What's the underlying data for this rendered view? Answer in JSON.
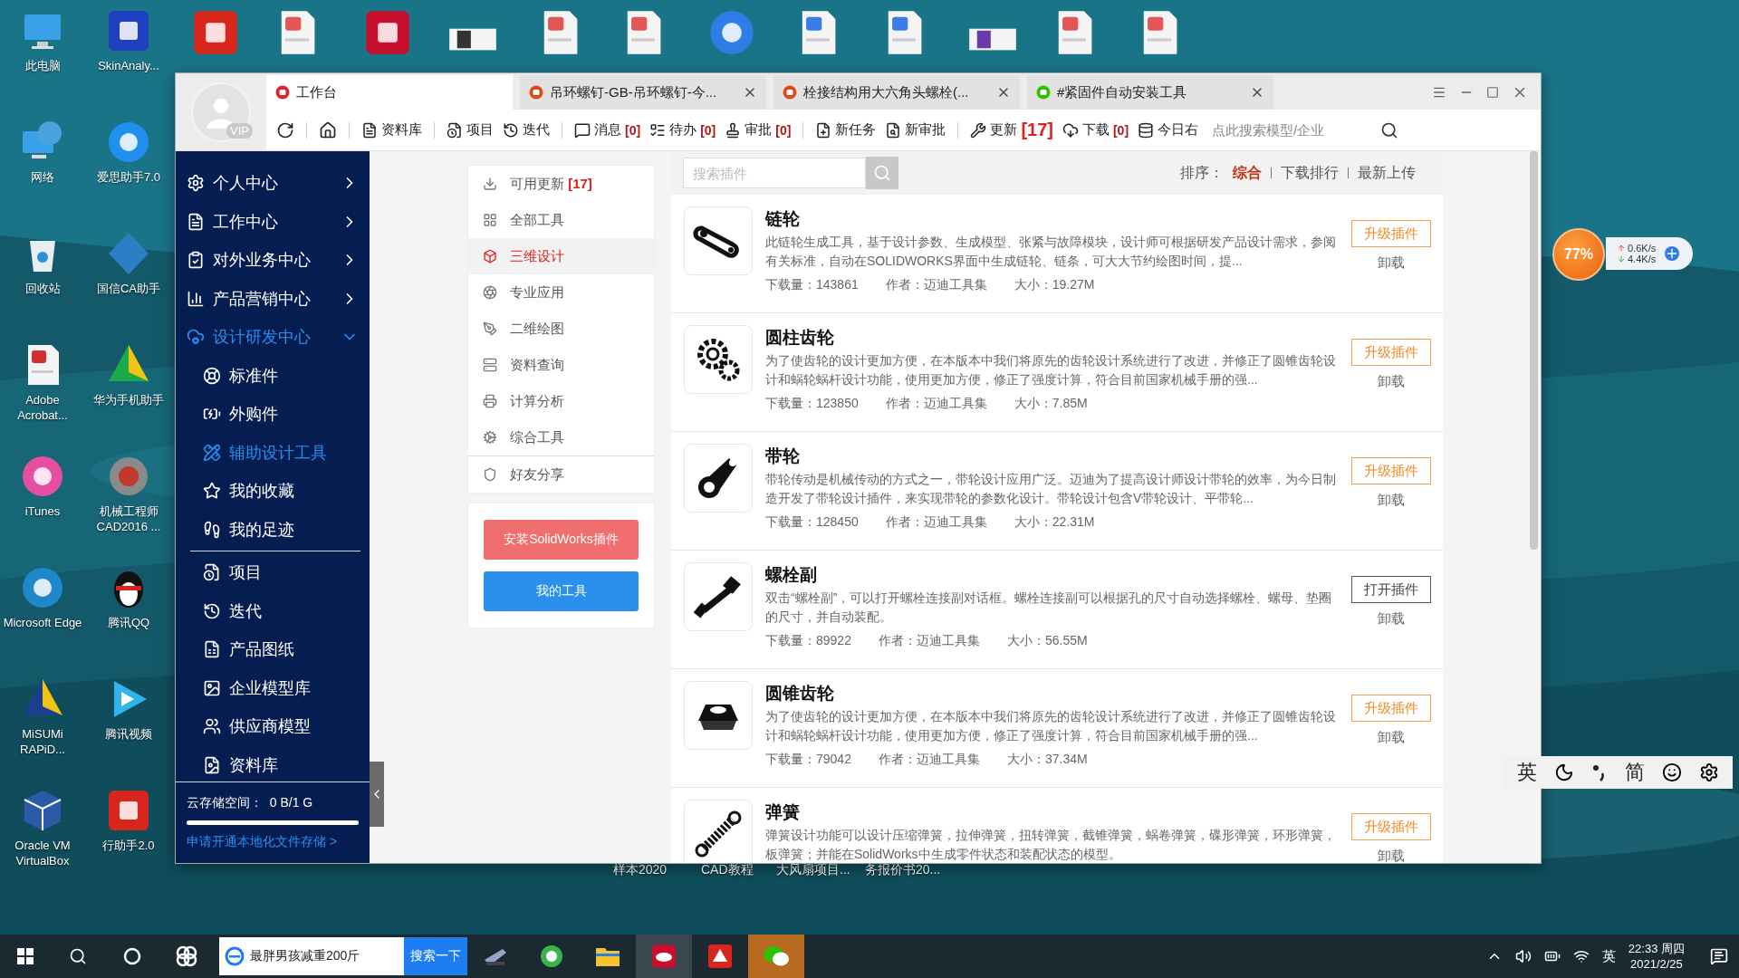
{
  "desktop": {
    "icons": [
      {
        "label": "此电脑"
      },
      {
        "label": "SkinAnaly..."
      },
      {
        "label": "网络"
      },
      {
        "label": "爱思助手7.0"
      },
      {
        "label": "回收站"
      },
      {
        "label": "国信CA助手"
      },
      {
        "label": "Adobe Acrobat..."
      },
      {
        "label": "华为手机助手"
      },
      {
        "label": "iTunes"
      },
      {
        "label": "机械工程师 CAD2016 ..."
      },
      {
        "label": "Microsoft Edge"
      },
      {
        "label": "腾讯QQ"
      },
      {
        "label": "MiSUMi RAPiD..."
      },
      {
        "label": "腾讯视频"
      },
      {
        "label": "Oracle VM VirtualBox"
      },
      {
        "label": "行助手2.0"
      }
    ],
    "bottom_labels": [
      "样本2020",
      "CAD教程",
      "大风扇项目...",
      "务报价书20..."
    ]
  },
  "window": {
    "avatar_badge": "VIP",
    "tabs": [
      {
        "label": "工作台",
        "selected": true
      },
      {
        "label": "吊环螺钉-GB-吊环螺钉-今...",
        "selected": false
      },
      {
        "label": "栓接结构用大六角头螺栓(...",
        "selected": false
      },
      {
        "label": "#紧固件自动安装工具",
        "selected": false
      }
    ],
    "toolbar": {
      "groups": [
        [
          {
            "label": "资料库"
          }
        ],
        [
          {
            "label": "项目"
          },
          {
            "label": "迭代"
          }
        ],
        [
          {
            "label": "消息",
            "count": "[0]"
          },
          {
            "label": "待办",
            "count": "[0]"
          },
          {
            "label": "审批",
            "count": "[0]"
          }
        ],
        [
          {
            "label": "新任务"
          },
          {
            "label": "新审批"
          }
        ],
        [
          {
            "label": "更新",
            "count": "[17]"
          },
          {
            "label": "下载",
            "count": "[0]"
          },
          {
            "label": "今日右"
          }
        ]
      ],
      "search_placeholder": "点此搜索模型/企业"
    },
    "sidebar": {
      "groups": [
        {
          "label": "个人中心",
          "expanded": false
        },
        {
          "label": "工作中心",
          "expanded": false
        },
        {
          "label": "对外业务中心",
          "expanded": false
        },
        {
          "label": "产品营销中心",
          "expanded": false
        },
        {
          "label": "设计研发中心",
          "expanded": true,
          "children": [
            {
              "label": "标准件",
              "selected": false
            },
            {
              "label": "外购件",
              "selected": false
            },
            {
              "label": "辅助设计工具",
              "selected": true
            },
            {
              "label": "我的收藏",
              "selected": false
            },
            {
              "label": "我的足迹",
              "selected": false
            }
          ]
        }
      ],
      "items": [
        "项目",
        "迭代",
        "产品图纸",
        "企业模型库",
        "供应商模型",
        "资料库"
      ],
      "storage": {
        "label": "云存储空间：",
        "value": "0 B/1 G",
        "level": 0,
        "link": "申请开通本地化文件存储 >"
      }
    },
    "categories": [
      {
        "label": "可用更新",
        "count": "[17]",
        "selected": false
      },
      {
        "label": "全部工具",
        "selected": false
      },
      {
        "label": "三维设计",
        "selected": true
      },
      {
        "label": "专业应用",
        "selected": false
      },
      {
        "label": "二维绘图",
        "selected": false
      },
      {
        "label": "资料查询",
        "selected": false
      },
      {
        "label": "计算分析",
        "selected": false
      },
      {
        "label": "综合工具",
        "selected": false
      },
      {
        "label": "好友分享",
        "selected": false
      }
    ],
    "buttons": [
      {
        "label": "安装SolidWorks插件",
        "kind": "install"
      },
      {
        "label": "我的工具",
        "kind": "tools"
      }
    ],
    "plugin_search": {
      "placeholder": "搜索插件"
    },
    "sort": {
      "label": "排序：",
      "options": [
        {
          "label": "综合",
          "selected": true
        },
        {
          "label": "下载排行",
          "selected": false
        },
        {
          "label": "最新上传",
          "selected": false
        }
      ]
    },
    "plugins": [
      {
        "name": "链轮",
        "description": "此链轮生成工具，基于设计参数、生成模型、张紧与故障模块，设计师可根据研发产品设计需求，参阅有关标准，自动在SOLIDWORKS界面中生成链轮、链条，可大大节约绘图时间，提...",
        "downloads": "下载量：143861",
        "author": "作者：迈迪工具集",
        "size": "大小：19.27M",
        "action": {
          "label": "升级插件",
          "kind": "upgrade"
        },
        "uninstall": "卸载"
      },
      {
        "name": "圆柱齿轮",
        "description": "为了使齿轮的设计更加方便，在本版本中我们将原先的齿轮设计系统进行了改进，并修正了圆锥齿轮设计和蜗轮蜗杆设计功能，使用更加方便，修正了强度计算，符合目前国家机械手册的强...",
        "downloads": "下载量：123850",
        "author": "作者：迈迪工具集",
        "size": "大小：7.85M",
        "action": {
          "label": "升级插件",
          "kind": "upgrade"
        },
        "uninstall": "卸载"
      },
      {
        "name": "带轮",
        "description": "带轮传动是机械传动的方式之一，带轮设计应用广泛。迈迪为了提高设计师设计带轮的效率，为今日制造开发了带轮设计插件，来实现带轮的参数化设计。带轮设计包含V带轮设计、平带轮...",
        "downloads": "下载量：128450",
        "author": "作者：迈迪工具集",
        "size": "大小：22.31M",
        "action": {
          "label": "升级插件",
          "kind": "upgrade"
        },
        "uninstall": "卸载"
      },
      {
        "name": "螺栓副",
        "description": "双击“螺栓副”，可以打开螺栓连接副对话框。螺栓连接副可以根据孔的尺寸自动选择螺栓、螺母、垫圈的尺寸，并自动装配。",
        "downloads": "下载量：89922",
        "author": "作者：迈迪工具集",
        "size": "大小：56.55M",
        "action": {
          "label": "打开插件",
          "kind": "open"
        },
        "uninstall": "卸载"
      },
      {
        "name": "圆锥齿轮",
        "description": "为了使齿轮的设计更加方便，在本版本中我们将原先的齿轮设计系统进行了改进，并修正了圆锥齿轮设计和蜗轮蜗杆设计功能，使用更加方便，修正了强度计算，符合目前国家机械手册的强...",
        "downloads": "下载量：79042",
        "author": "作者：迈迪工具集",
        "size": "大小：37.34M",
        "action": {
          "label": "升级插件",
          "kind": "upgrade"
        },
        "uninstall": "卸载"
      },
      {
        "name": "弹簧",
        "description": "弹簧设计功能可以设计压缩弹簧，拉伸弹簧，扭转弹簧，截锥弹簧，蜗卷弹簧，碟形弹簧，环形弹簧，板弹簧；并能在SolidWorks中生成零件状态和装配状态的模型。",
        "action": {
          "label": "升级插件",
          "kind": "upgrade"
        },
        "uninstall": "卸载"
      }
    ]
  },
  "net_widget": {
    "percent": "77%",
    "upload": "0.6K/s",
    "download": "4.4K/s"
  },
  "ime_bar": {
    "language": "英",
    "script": "简"
  },
  "taskbar": {
    "search_text": "最胖男孩减重200斤",
    "search_button": "搜索一下",
    "ime": "英",
    "time": "22:33 周四",
    "date": "2021/2/25"
  }
}
